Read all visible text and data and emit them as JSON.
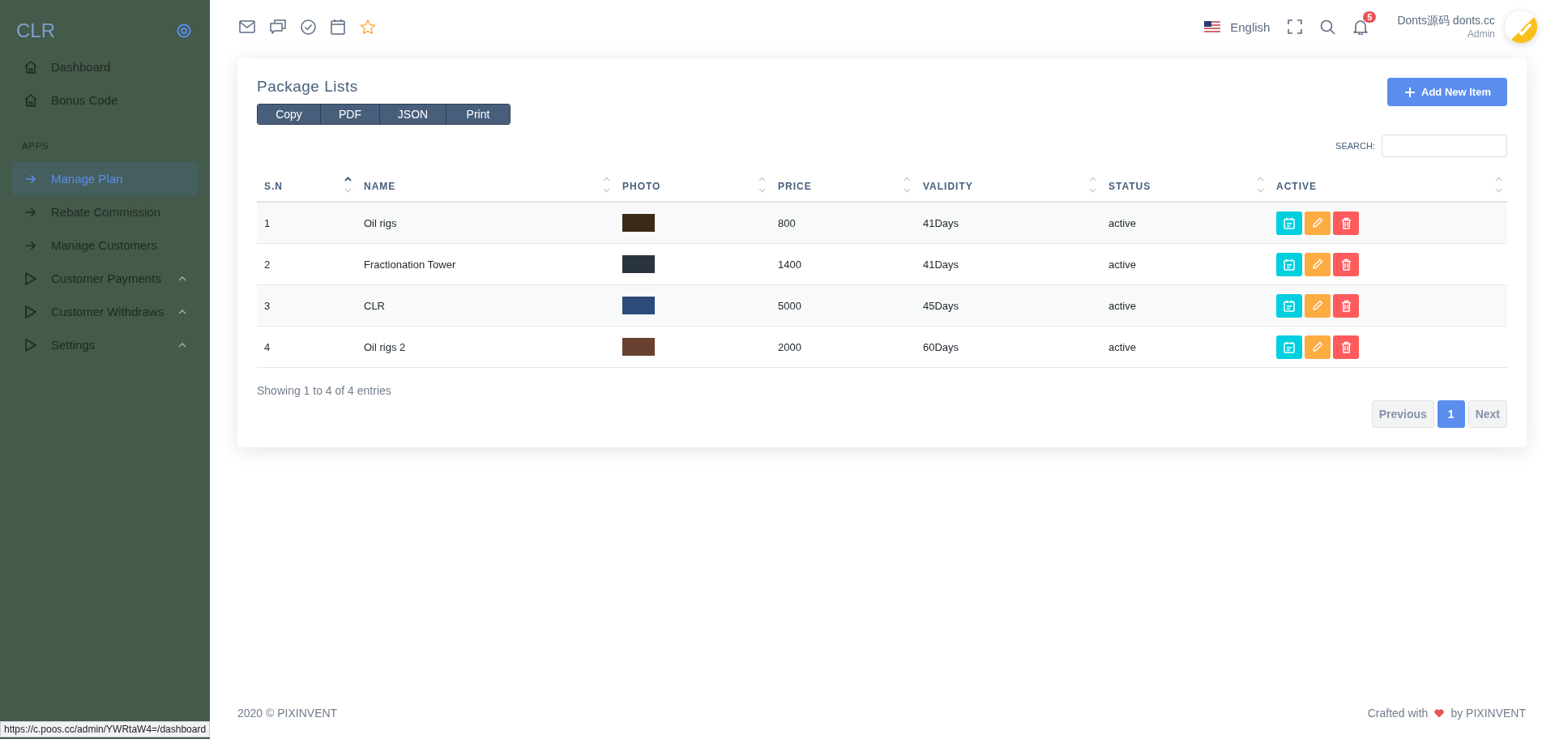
{
  "sidebar": {
    "brand": "CLR",
    "groups": [
      {
        "items": [
          {
            "label": "Dashboard",
            "kind": "home",
            "selected": false,
            "expandable": false
          },
          {
            "label": "Bonus Code",
            "kind": "home",
            "selected": false,
            "expandable": false
          }
        ]
      },
      {
        "heading": "APPS",
        "items": [
          {
            "label": "Manage Plan",
            "kind": "arrow",
            "selected": true,
            "expandable": false
          },
          {
            "label": "Rebate Commission",
            "kind": "arrow",
            "selected": false,
            "expandable": false
          },
          {
            "label": "Manage Customers",
            "kind": "arrow",
            "selected": false,
            "expandable": false
          },
          {
            "label": "Customer Payments",
            "kind": "triangle",
            "selected": false,
            "expandable": true
          },
          {
            "label": "Customer Withdraws",
            "kind": "triangle",
            "selected": false,
            "expandable": true
          },
          {
            "label": "Settings",
            "kind": "triangle",
            "selected": false,
            "expandable": true
          }
        ]
      }
    ]
  },
  "topbar": {
    "icons": [
      {
        "kind": "mail"
      },
      {
        "kind": "chat"
      },
      {
        "kind": "check"
      },
      {
        "kind": "calendar"
      },
      {
        "kind": "star"
      }
    ],
    "language": "English",
    "notifications": "5",
    "user_name": "Donts源码 donts.cc",
    "user_role": "Admin"
  },
  "card": {
    "title": "Package Lists",
    "export_buttons": [
      "Copy",
      "PDF",
      "JSON",
      "Print"
    ],
    "add_button": "Add New Item",
    "search_label": "SEARCH:",
    "columns": [
      {
        "label": "S.N",
        "sorted": true
      },
      {
        "label": "NAME",
        "sorted": false
      },
      {
        "label": "PHOTO",
        "sorted": false
      },
      {
        "label": "PRICE",
        "sorted": false
      },
      {
        "label": "VALIDITY",
        "sorted": false
      },
      {
        "label": "STATUS",
        "sorted": false
      },
      {
        "label": "ACTIVE",
        "sorted": false
      }
    ],
    "rows": [
      {
        "sn": "1",
        "name": "Oil rigs",
        "price": "800",
        "validity": "41Days",
        "status": "active"
      },
      {
        "sn": "2",
        "name": "Fractionation Tower",
        "price": "1400",
        "validity": "41Days",
        "status": "active"
      },
      {
        "sn": "3",
        "name": "CLR",
        "price": "5000",
        "validity": "45Days",
        "status": "active"
      },
      {
        "sn": "4",
        "name": "Oil rigs 2",
        "price": "2000",
        "validity": "60Days",
        "status": "active"
      }
    ],
    "info": "Showing 1 to 4 of 4 entries",
    "pagination": [
      {
        "label": "Previous",
        "kind": "nav",
        "selected": false
      },
      {
        "label": "1",
        "kind": "page",
        "selected": true
      },
      {
        "label": "Next",
        "kind": "nav",
        "selected": false
      }
    ]
  },
  "footer": {
    "copyright": "2020 © PIXINVENT",
    "credit_before": "Crafted with",
    "credit_after": "by PIXINVENT"
  },
  "status_url": "https://c.poos.cc/admin/YWRtaW4=/dashboard"
}
